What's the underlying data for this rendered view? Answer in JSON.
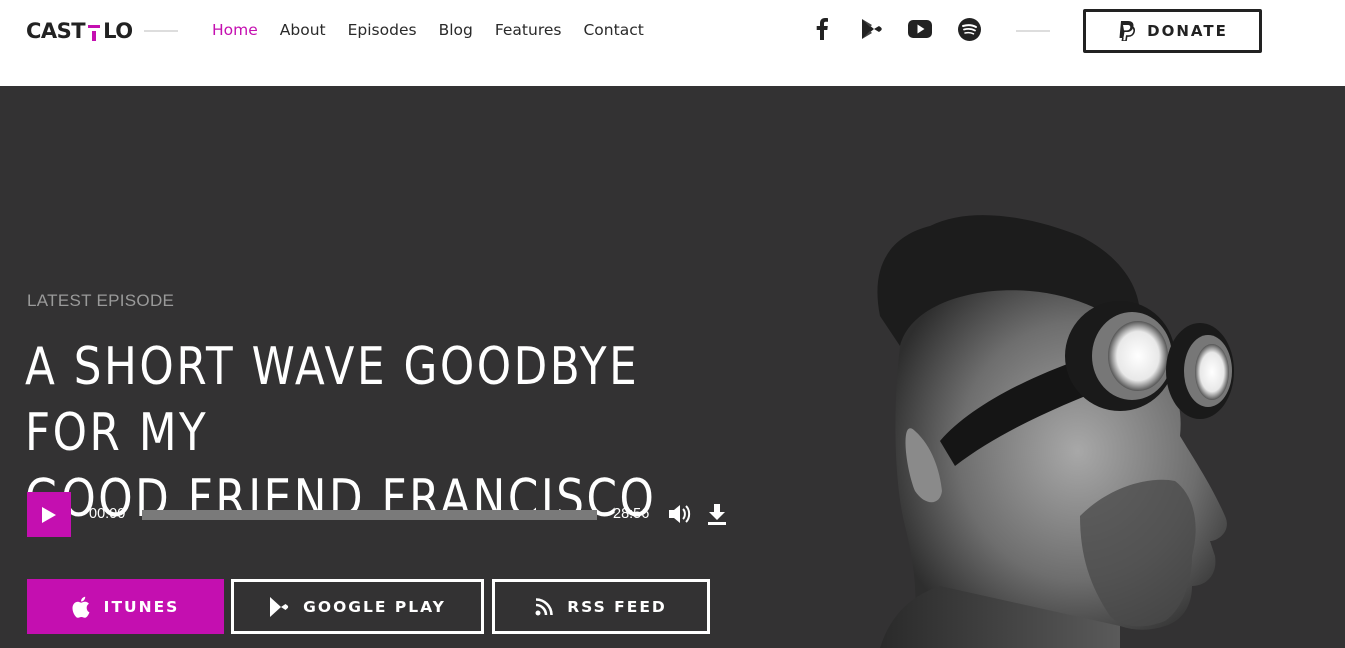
{
  "brand": {
    "left": "CAST",
    "right": "LO",
    "accent": "#c40fb0"
  },
  "nav": {
    "items": [
      {
        "label": "Home",
        "active": true
      },
      {
        "label": "About",
        "active": false
      },
      {
        "label": "Episodes",
        "active": false
      },
      {
        "label": "Blog",
        "active": false
      },
      {
        "label": "Features",
        "active": false
      },
      {
        "label": "Contact",
        "active": false
      }
    ]
  },
  "socials": [
    "facebook-icon",
    "google-play-icon",
    "youtube-icon",
    "spotify-icon"
  ],
  "donate": {
    "label": "DONATE",
    "icon": "paypal-icon"
  },
  "hero": {
    "kicker": "LATEST EPISODE",
    "title_line1": "A SHORT WAVE GOODBYE FOR MY",
    "title_line2": "GOOD FRIEND FRANCISCO",
    "background": "#333233"
  },
  "player": {
    "current_time": "00:00",
    "duration": "28:56",
    "progress": 0.0
  },
  "subscribe": {
    "itunes": "ITUNES",
    "google_play": "GOOGLE PLAY",
    "rss": "RSS FEED"
  }
}
